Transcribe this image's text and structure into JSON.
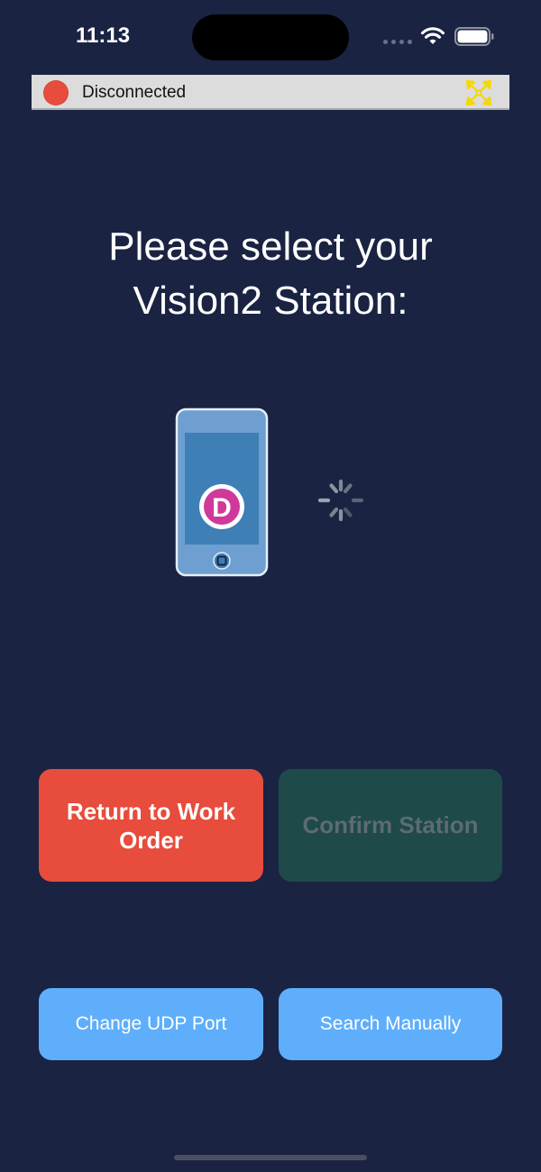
{
  "status_bar": {
    "time": "11:13"
  },
  "connection": {
    "status_label": "Disconnected",
    "status_color": "#e74c3c",
    "expand_icon": "expand-arrows-icon",
    "expand_icon_color": "#f5d800"
  },
  "main": {
    "title_line1": "Please select your",
    "title_line2": "Vision2 Station:",
    "device_icon": "phone-device-icon",
    "device_logo_letter": "D",
    "loading_icon": "activity-spinner-icon"
  },
  "buttons": {
    "return_label": "Return to Work Order",
    "confirm_label": "Confirm Station",
    "udp_label": "Change UDP Port",
    "search_label": "Search Manually"
  },
  "colors": {
    "background": "#1a2342",
    "return_button": "#e74c3c",
    "confirm_button_disabled": "#1e4a4a",
    "secondary_button": "#5eaefc"
  }
}
